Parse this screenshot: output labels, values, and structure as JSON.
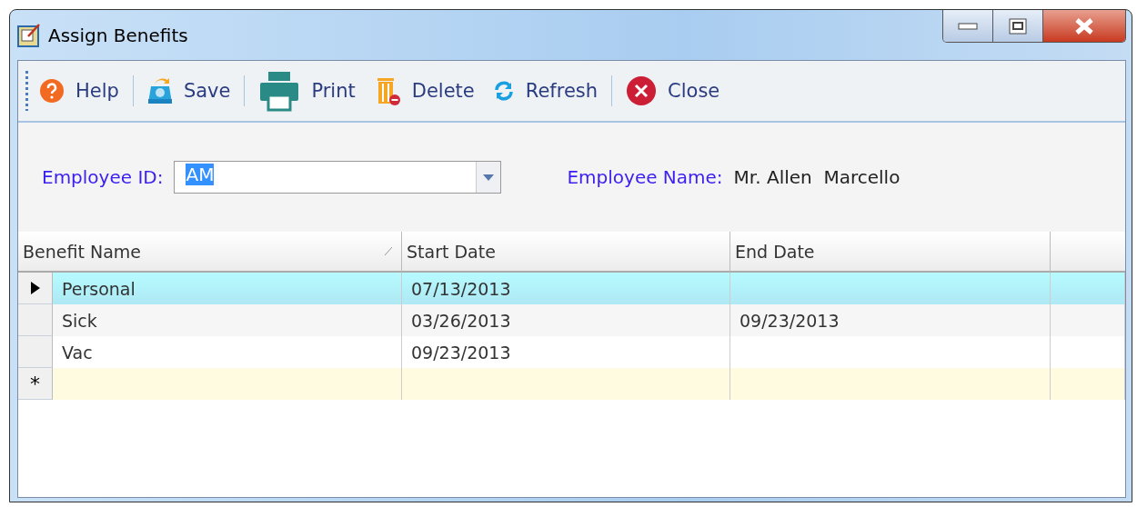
{
  "window": {
    "title": "Assign Benefits"
  },
  "toolbar": [
    {
      "kind": "help",
      "label": "Help",
      "separator_after": true
    },
    {
      "kind": "save",
      "label": "Save",
      "separator_after": true
    },
    {
      "kind": "print",
      "label": "Print",
      "separator_after": false
    },
    {
      "kind": "delete",
      "label": "Delete",
      "separator_after": false
    },
    {
      "kind": "refresh",
      "label": "Refresh",
      "separator_after": true
    },
    {
      "kind": "close",
      "label": "Close",
      "separator_after": false
    }
  ],
  "form": {
    "employee_id_label": "Employee ID:",
    "employee_id_value": "AM",
    "employee_name_label": "Employee Name:",
    "employee_name_value": "Mr. Allen  Marcello"
  },
  "table": {
    "columns": [
      {
        "label": "Benefit Name",
        "sorted": true
      },
      {
        "label": "Start Date",
        "sorted": false
      },
      {
        "label": "End Date",
        "sorted": false
      }
    ],
    "rows": [
      {
        "cells": [
          "Personal",
          "07/13/2013",
          ""
        ],
        "selected": true
      },
      {
        "cells": [
          "Sick",
          "03/26/2013",
          "09/23/2013"
        ],
        "selected": false
      },
      {
        "cells": [
          "Vac",
          "09/23/2013",
          ""
        ],
        "selected": false
      }
    ],
    "new_row": {
      "marker": "*"
    }
  }
}
